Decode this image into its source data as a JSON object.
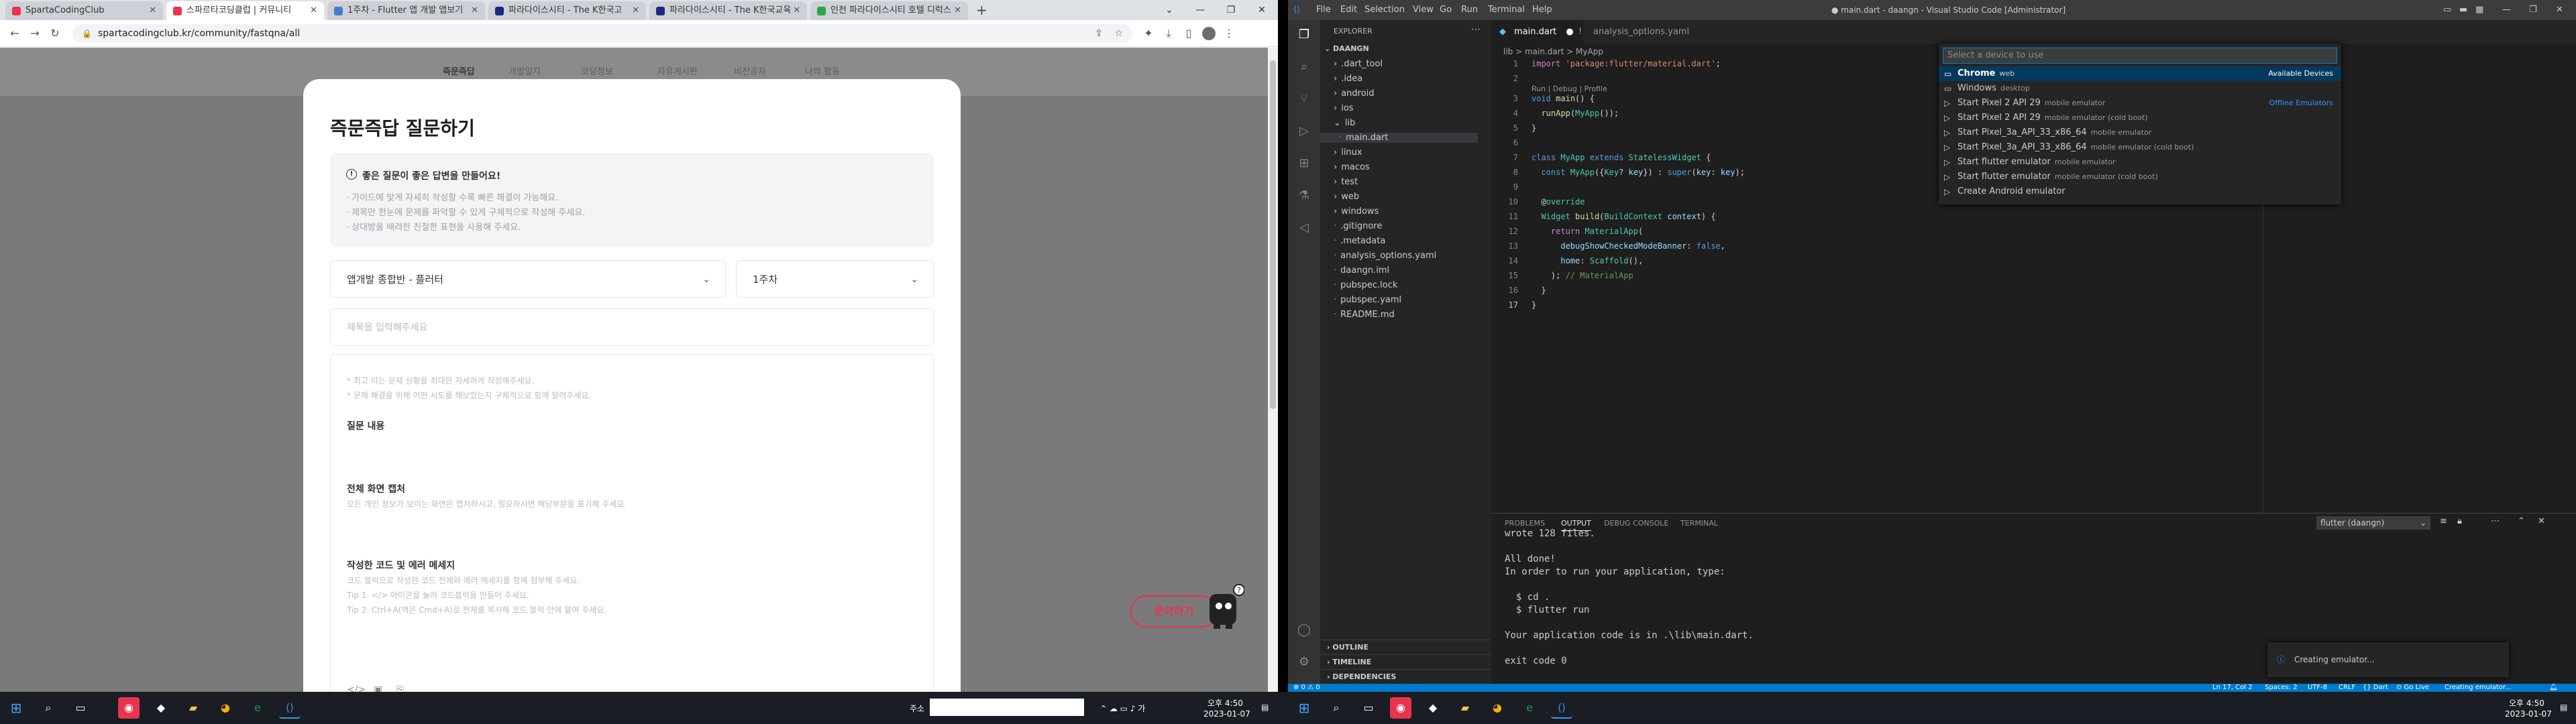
{
  "browser": {
    "tabs": [
      {
        "title": "SpartaCodingClub",
        "color": "#e8344e"
      },
      {
        "title": "스파르타코딩클럽 | 커뮤니티",
        "color": "#e8344e"
      },
      {
        "title": "1주차 - Flutter 앱 개발 앱보기",
        "color": "#4a7bd0"
      },
      {
        "title": "파라다이스시티 - The K한국고",
        "color": "#1a2a80"
      },
      {
        "title": "파라다이스시티 - The K한국교육",
        "color": "#1a2a80"
      },
      {
        "title": "인천 파라다이스시티 호텔 디럭스",
        "color": "#2aa84a"
      }
    ],
    "new_tab": "+",
    "url": "spartacodingclub.kr/community/fastqna/all",
    "nav_items": [
      "즉문즉답",
      "개발일지",
      "코딩정보",
      "자유게시판",
      "비전공자",
      "나의 활동"
    ],
    "modal": {
      "title": "즉문즉답 질문하기",
      "tip_head": "좋은 질문이 좋은 답변을 만들어요!",
      "tips": [
        "· 가이드에 맞게 자세히 작성할 수록 빠른 해결이 가능해요.",
        "· 제목만 한눈에 문제를 파악할 수 있게 구체적으로 작성해 주세요.",
        "· 상대방을 배려한 친절한 표현을 사용해 주세요."
      ],
      "course_select": "앱개발 종합반 - 플러터",
      "week_select": "1주차",
      "title_placeholder": "제목을 입력해주세요",
      "editor_notes": [
        "* 최고 이는 문제 상황을 최대한 자세하게 작성해주세요.",
        "* 문제 해결을 위해 어떤 시도를 해보았는지 구체적으로 함께 알려주세요."
      ],
      "sections": [
        {
          "head": "질문 내용",
          "sub": ""
        },
        {
          "head": "전체 화면 캡처",
          "sub": "모든 개인 정보가 보이는 화면은 캡처하시고, 필요하시면 해당부분을 표기해 주세요."
        },
        {
          "head": "작성한 코드 및 에러 메세지",
          "sub": "코드 블럭으로 작성한 코드 전체와 에러 메세지를 함께 첨부해 주세요."
        }
      ],
      "section_tips": [
        "Tip 1. </> 아이콘을 눌러 코드블럭을 만들어 주세요.",
        "Tip 2. Ctrl+A(맥은 Cmd+A)로 전체를 복사해 코드 블럭 안에 붙여 주세요."
      ]
    },
    "ask_button": "문의하기"
  },
  "vscode": {
    "menu": [
      "File",
      "Edit",
      "Selection",
      "View",
      "Go",
      "Run",
      "Terminal",
      "Help"
    ],
    "window_title": "● main.dart - daangn - Visual Studio Code [Administrator]",
    "explorer_title": "EXPLORER",
    "project": "DAANGN",
    "tree": [
      {
        "name": ".dart_tool",
        "kind": "folder",
        "depth": 0
      },
      {
        "name": ".idea",
        "kind": "folder",
        "depth": 0
      },
      {
        "name": "android",
        "kind": "folder",
        "depth": 0
      },
      {
        "name": "ios",
        "kind": "folder",
        "depth": 0
      },
      {
        "name": "lib",
        "kind": "folder-open",
        "depth": 0
      },
      {
        "name": "main.dart",
        "kind": "file",
        "depth": 1
      },
      {
        "name": "linux",
        "kind": "folder",
        "depth": 0
      },
      {
        "name": "macos",
        "kind": "folder",
        "depth": 0
      },
      {
        "name": "test",
        "kind": "folder",
        "depth": 0
      },
      {
        "name": "web",
        "kind": "folder",
        "depth": 0
      },
      {
        "name": "windows",
        "kind": "folder",
        "depth": 0
      },
      {
        "name": ".gitignore",
        "kind": "file",
        "depth": 0
      },
      {
        "name": ".metadata",
        "kind": "file",
        "depth": 0
      },
      {
        "name": "analysis_options.yaml",
        "kind": "file",
        "depth": 0
      },
      {
        "name": "daangn.iml",
        "kind": "file",
        "depth": 0
      },
      {
        "name": "pubspec.lock",
        "kind": "file",
        "depth": 0
      },
      {
        "name": "pubspec.yaml",
        "kind": "file",
        "depth": 0
      },
      {
        "name": "README.md",
        "kind": "file",
        "depth": 0
      }
    ],
    "sidebar_sections": [
      "OUTLINE",
      "TIMELINE",
      "DEPENDENCIES"
    ],
    "editor_tabs": [
      "main.dart",
      "analysis_options.yaml"
    ],
    "breadcrumbs": "lib > main.dart > MyApp",
    "codelens": "Run | Debug | Profile",
    "line_numbers": [
      "1",
      "2",
      "3",
      "4",
      "5",
      "6",
      "7",
      "8",
      "9",
      "10",
      "11",
      "12",
      "13",
      "14",
      "15",
      "16",
      "17"
    ],
    "quick_pick": {
      "placeholder": "Select a device to use",
      "items": [
        {
          "label": "Chrome",
          "desc": "web",
          "right": "Available Devices"
        },
        {
          "label": "Windows",
          "desc": "desktop",
          "right": ""
        },
        {
          "label": "Start Pixel 2 API 29",
          "desc": "mobile emulator",
          "right": "Offline Emulators"
        },
        {
          "label": "Start Pixel 2 API 29",
          "desc": "mobile emulator (cold boot)",
          "right": ""
        },
        {
          "label": "Start Pixel_3a_API_33_x86_64",
          "desc": "mobile emulator",
          "right": ""
        },
        {
          "label": "Start Pixel_3a_API_33_x86_64",
          "desc": "mobile emulator (cold boot)",
          "right": ""
        },
        {
          "label": "Start flutter emulator",
          "desc": "mobile emulator",
          "right": ""
        },
        {
          "label": "Start flutter emulator",
          "desc": "mobile emulator (cold boot)",
          "right": ""
        },
        {
          "label": "Create Android emulator",
          "desc": "",
          "right": ""
        }
      ]
    },
    "panel_tabs": [
      "PROBLEMS",
      "OUTPUT",
      "DEBUG CONSOLE",
      "TERMINAL"
    ],
    "panel_select": "flutter (daangn)",
    "output_lines": [
      "wrote 128 files.",
      "",
      "All done!",
      "In order to run your application, type:",
      "",
      "  $ cd .",
      "  $ flutter run",
      "",
      "Your application code is in .\\lib\\main.dart.",
      "",
      "exit code 0"
    ],
    "toast": "Creating emulator...",
    "status_left": "⊗ 0 ⚠ 0",
    "status_right": [
      "Ln 17, Col 2",
      "Spaces: 2",
      "UTF-8",
      "CRLF",
      "{} Dart",
      "⊙ Go Live",
      "Creating emulator..."
    ]
  },
  "taskbar_left": {
    "search": "주소",
    "time": "오후 4:50",
    "date": "2023-01-07"
  },
  "taskbar_right": {
    "time": "오후 4:50",
    "date": "2023-01-07"
  }
}
